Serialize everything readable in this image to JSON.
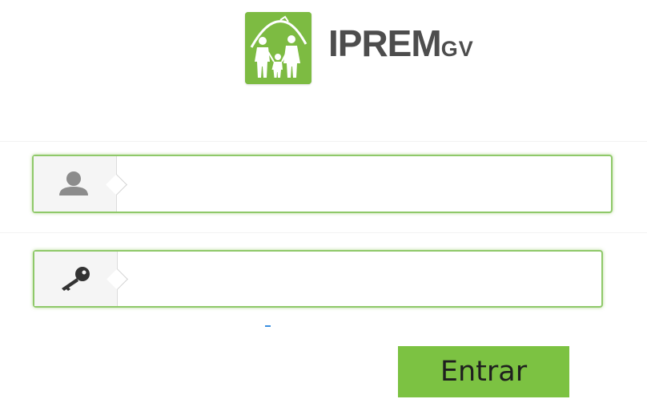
{
  "logo": {
    "name_main": "IPREM",
    "name_sub": "GV",
    "brand_color": "#7dbb42",
    "icon": "family-house-logo"
  },
  "login_form": {
    "username": {
      "icon": "user-icon",
      "value": "",
      "placeholder": ""
    },
    "password": {
      "icon": "key-icon",
      "value": "",
      "placeholder": ""
    },
    "focus_border_color": "#8fc96a",
    "submit_label": "Entrar",
    "submit_color": "#7cc242"
  }
}
